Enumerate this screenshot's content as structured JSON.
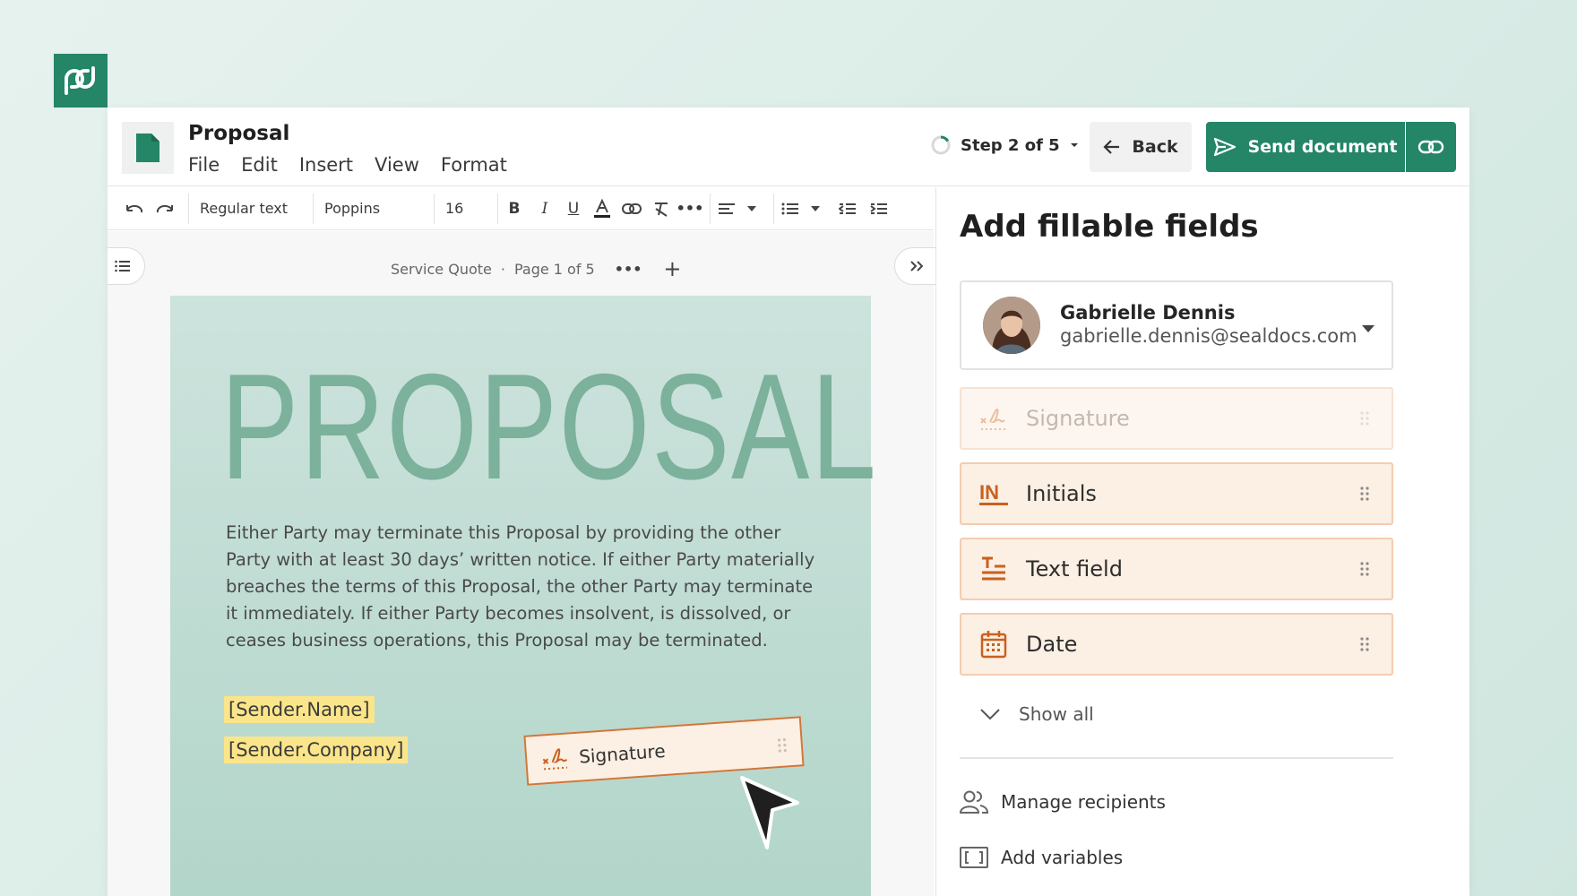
{
  "colors": {
    "brand_green": "#248567",
    "field_bg": "#fcefe3",
    "field_border": "#f2cdb2",
    "field_icon": "#c9611e",
    "tag_yellow": "#fbe58a"
  },
  "header": {
    "doc_title": "Proposal",
    "menu": [
      "File",
      "Edit",
      "Insert",
      "View",
      "Format"
    ],
    "step_label": "Step 2 of 5",
    "back_label": "Back",
    "send_label": "Send document"
  },
  "toolbar": {
    "text_style": "Regular text",
    "font_name": "Poppins",
    "font_size": "16"
  },
  "editor": {
    "doc_name": "Service Quote",
    "page_label": "Page 1 of 5",
    "heading": "PROPOSAL",
    "body": "Either Party may terminate this Proposal by providing the other Party with at least 30 days’ written notice. If either Party materially breaches the terms of this Proposal, the other Party may terminate it immediately. If either Party becomes insolvent, is dissolved, or ceases business operations, this Proposal may be terminated.",
    "tags": [
      "[Sender.Name]",
      "[Sender.Company]"
    ],
    "dragged_field_label": "Signature"
  },
  "panel": {
    "title": "Add fillable fields",
    "recipient": {
      "name": "Gabrielle Dennis",
      "email": "gabrielle.dennis@sealdocs.com"
    },
    "fields": [
      {
        "label": "Signature",
        "icon": "signature-icon"
      },
      {
        "label": "Initials",
        "icon": "initials-icon"
      },
      {
        "label": "Text field",
        "icon": "text-field-icon"
      },
      {
        "label": "Date",
        "icon": "calendar-icon"
      }
    ],
    "show_all": "Show all",
    "manage_recipients": "Manage recipients",
    "add_variables": "Add variables"
  }
}
